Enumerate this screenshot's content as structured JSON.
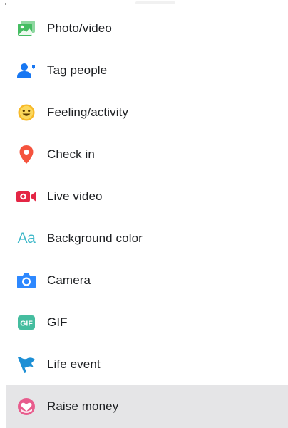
{
  "menu": {
    "items": [
      {
        "label": "Photo/video",
        "icon": "photo-video-icon",
        "color": "#45bd62"
      },
      {
        "label": "Tag people",
        "icon": "tag-people-icon",
        "color": "#1877f2"
      },
      {
        "label": "Feeling/activity",
        "icon": "feeling-activity-icon",
        "color": "#f7b928"
      },
      {
        "label": "Check in",
        "icon": "check-in-icon",
        "color": "#f5533d"
      },
      {
        "label": "Live video",
        "icon": "live-video-icon",
        "color": "#e42645"
      },
      {
        "label": "Background color",
        "icon": "background-color-icon",
        "color": "#3fb8c9",
        "icon_text": "Aa"
      },
      {
        "label": "Camera",
        "icon": "camera-icon",
        "color": "#2d88ff"
      },
      {
        "label": "GIF",
        "icon": "gif-icon",
        "color": "#45bd9f",
        "icon_text": "GIF"
      },
      {
        "label": "Life event",
        "icon": "life-event-icon",
        "color": "#1d8fd5"
      },
      {
        "label": "Raise money",
        "icon": "raise-money-icon",
        "color": "#e85c8d",
        "highlighted": true
      }
    ]
  }
}
